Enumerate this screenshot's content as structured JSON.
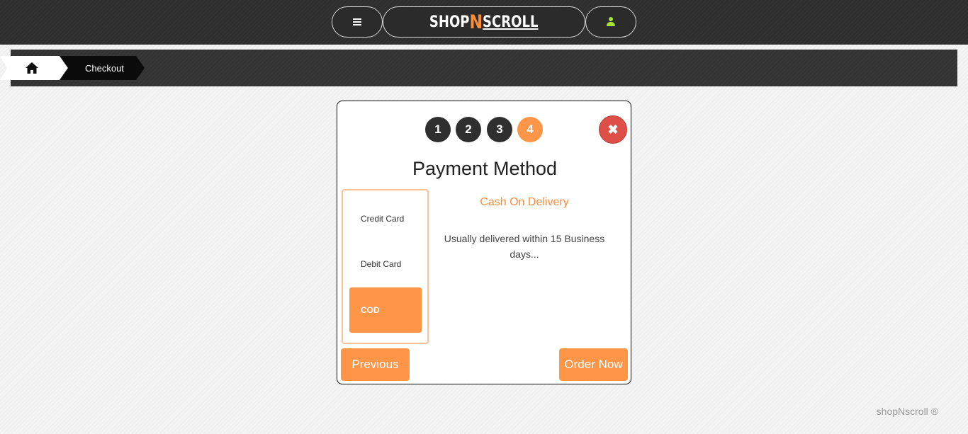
{
  "header": {
    "logo_part1": "SHOP",
    "logo_accent": "N",
    "logo_part2": "SCROLL",
    "accent_color": "#ff8c2e",
    "user_icon_color": "#a4e233"
  },
  "breadcrumb": {
    "home_icon": "home-icon",
    "current": "Checkout"
  },
  "modal": {
    "steps": [
      "1",
      "2",
      "3",
      "4"
    ],
    "active_step": "4",
    "close_icon": "✖",
    "title": "Payment Method",
    "payment_options": [
      "Credit Card",
      "Debit Card",
      "COD"
    ],
    "selected_option": "COD",
    "selected_option_title": "Cash On Delivery",
    "selected_option_description": "Usually delivered within 15 Business days...",
    "previous_label": "Previous",
    "order_label": "Order Now"
  },
  "footer": {
    "text": "shopNscroll ®"
  }
}
